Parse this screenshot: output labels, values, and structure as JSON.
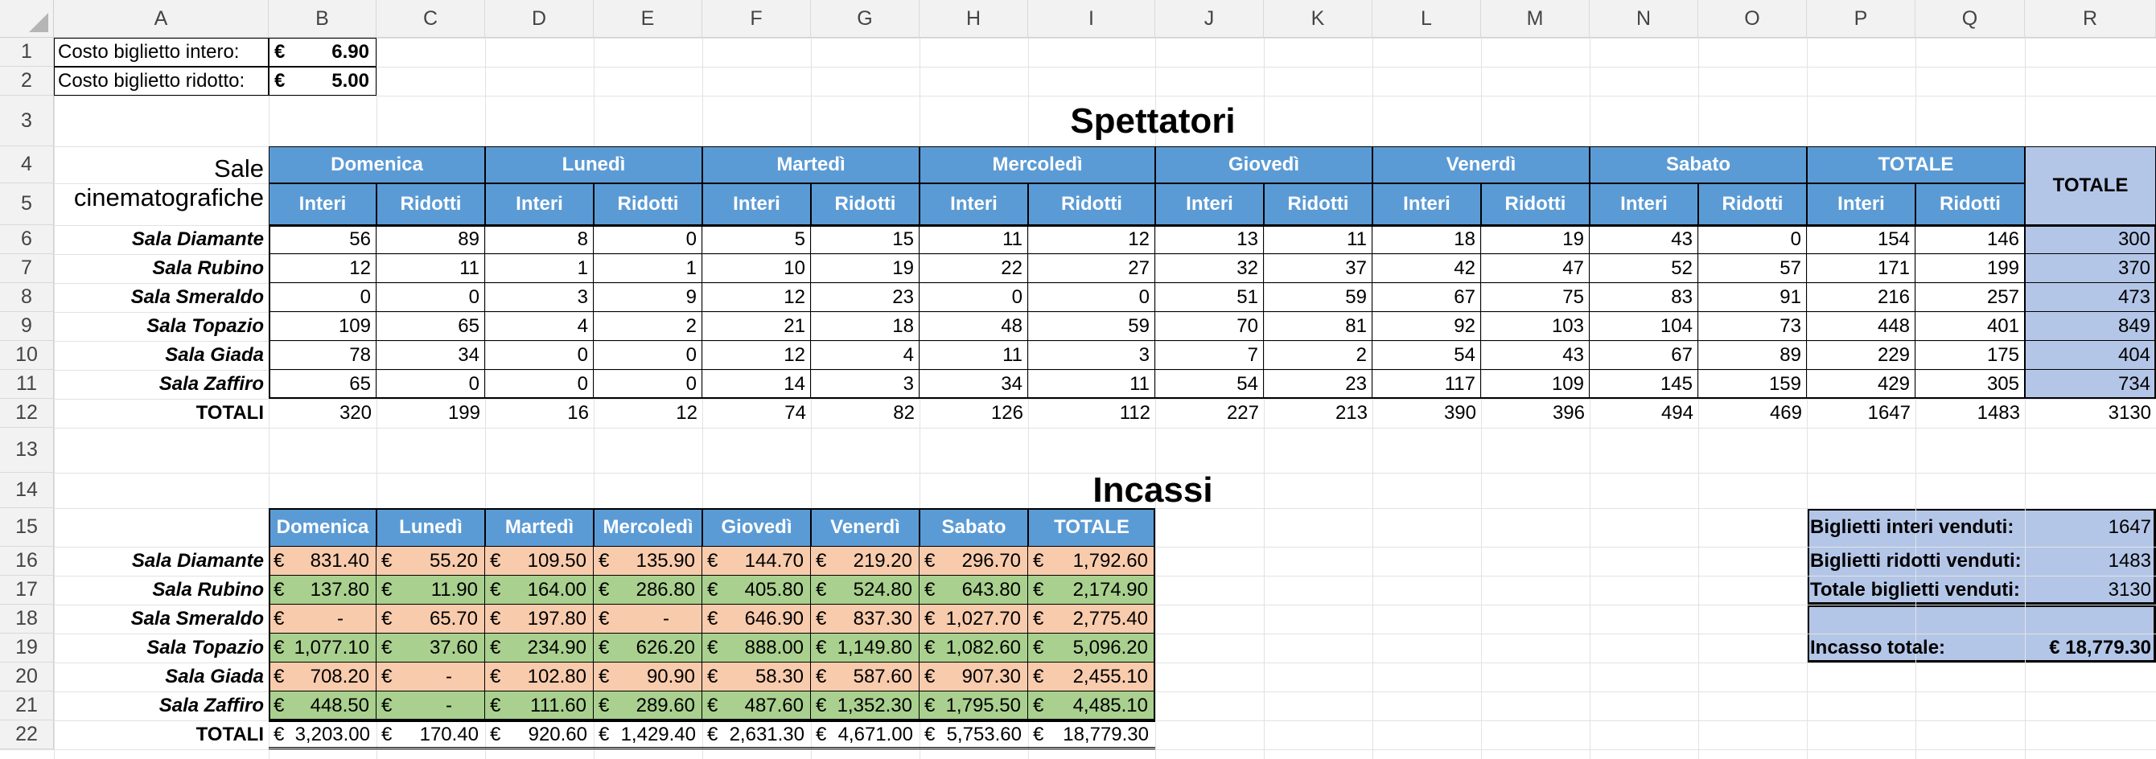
{
  "columns": [
    "A",
    "B",
    "C",
    "D",
    "E",
    "F",
    "G",
    "H",
    "I",
    "J",
    "K",
    "L",
    "M",
    "N",
    "O",
    "P",
    "Q",
    "R"
  ],
  "rows": [
    "1",
    "2",
    "3",
    "4",
    "5",
    "6",
    "7",
    "8",
    "9",
    "10",
    "11",
    "12",
    "13",
    "14",
    "15",
    "16",
    "17",
    "18",
    "19",
    "20",
    "21",
    "22"
  ],
  "prices": {
    "intero_label": "Costo biglietto intero:",
    "intero_cur": "€",
    "intero_val": "6.90",
    "ridotto_label": "Costo biglietto ridotto:",
    "ridotto_cur": "€",
    "ridotto_val": "5.00"
  },
  "spettatori": {
    "title": "Spettatori",
    "corner_label_1": "Sale",
    "corner_label_2": "cinematografiche",
    "days": [
      "Domenica",
      "Lunedì",
      "Martedì",
      "Mercoledì",
      "Giovedì",
      "Venerdì",
      "Sabato",
      "TOTALE"
    ],
    "sub": [
      "Interi",
      "Ridotti"
    ],
    "grand_header": "TOTALE",
    "rows": [
      {
        "name": "Sala Diamante",
        "vals": [
          "56",
          "89",
          "8",
          "0",
          "5",
          "15",
          "11",
          "12",
          "13",
          "11",
          "18",
          "19",
          "43",
          "0",
          "154",
          "146"
        ],
        "total": "300"
      },
      {
        "name": "Sala Rubino",
        "vals": [
          "12",
          "11",
          "1",
          "1",
          "10",
          "19",
          "22",
          "27",
          "32",
          "37",
          "42",
          "47",
          "52",
          "57",
          "171",
          "199"
        ],
        "total": "370"
      },
      {
        "name": "Sala Smeraldo",
        "vals": [
          "0",
          "0",
          "3",
          "9",
          "12",
          "23",
          "0",
          "0",
          "51",
          "59",
          "67",
          "75",
          "83",
          "91",
          "216",
          "257"
        ],
        "total": "473"
      },
      {
        "name": "Sala Topazio",
        "vals": [
          "109",
          "65",
          "4",
          "2",
          "21",
          "18",
          "48",
          "59",
          "70",
          "81",
          "92",
          "103",
          "104",
          "73",
          "448",
          "401"
        ],
        "total": "849"
      },
      {
        "name": "Sala Giada",
        "vals": [
          "78",
          "34",
          "0",
          "0",
          "12",
          "4",
          "11",
          "3",
          "7",
          "2",
          "54",
          "43",
          "67",
          "89",
          "229",
          "175"
        ],
        "total": "404"
      },
      {
        "name": "Sala Zaffiro",
        "vals": [
          "65",
          "0",
          "0",
          "0",
          "14",
          "3",
          "34",
          "11",
          "54",
          "23",
          "117",
          "109",
          "145",
          "159",
          "429",
          "305"
        ],
        "total": "734"
      }
    ],
    "totals_label": "TOTALI",
    "totals": [
      "320",
      "199",
      "16",
      "12",
      "74",
      "82",
      "126",
      "112",
      "227",
      "213",
      "390",
      "396",
      "494",
      "469",
      "1647",
      "1483"
    ],
    "grand_total": "3130"
  },
  "incassi": {
    "title": "Incassi",
    "headers": [
      "Domenica",
      "Lunedì",
      "Martedì",
      "Mercoledì",
      "Giovedì",
      "Venerdì",
      "Sabato",
      "TOTALE"
    ],
    "currency": "€",
    "rows": [
      {
        "name": "Sala Diamante",
        "vals": [
          "831.40",
          "55.20",
          "109.50",
          "135.90",
          "144.70",
          "219.20",
          "296.70",
          "1,792.60"
        ]
      },
      {
        "name": "Sala Rubino",
        "vals": [
          "137.80",
          "11.90",
          "164.00",
          "286.80",
          "405.80",
          "524.80",
          "643.80",
          "2,174.90"
        ]
      },
      {
        "name": "Sala Smeraldo",
        "vals": [
          "-",
          "65.70",
          "197.80",
          "-",
          "646.90",
          "837.30",
          "1,027.70",
          "2,775.40"
        ]
      },
      {
        "name": "Sala Topazio",
        "vals": [
          "1,077.10",
          "37.60",
          "234.90",
          "626.20",
          "888.00",
          "1,149.80",
          "1,082.60",
          "5,096.20"
        ]
      },
      {
        "name": "Sala Giada",
        "vals": [
          "708.20",
          "-",
          "102.80",
          "90.90",
          "58.30",
          "587.60",
          "907.30",
          "2,455.10"
        ]
      },
      {
        "name": "Sala Zaffiro",
        "vals": [
          "448.50",
          "-",
          "111.60",
          "289.60",
          "487.60",
          "1,352.30",
          "1,795.50",
          "4,485.10"
        ]
      }
    ],
    "totals_label": "TOTALI",
    "totals": [
      "3,203.00",
      "170.40",
      "920.60",
      "1,429.40",
      "2,631.30",
      "4,671.00",
      "5,753.60",
      "18,779.30"
    ]
  },
  "summary": {
    "interi_label": "Biglietti interi venduti:",
    "interi_val": "1647",
    "ridotti_label": "Biglietti ridotti venduti:",
    "ridotti_val": "1483",
    "totale_label": "Totale biglietti venduti:",
    "totale_val": "3130",
    "incasso_label": "Incasso totale:",
    "incasso_val": "€ 18,779.30"
  },
  "colors": {
    "header_blue": "#5b9bd5",
    "total_blue": "#b4c6e7",
    "peach": "#f8cbad",
    "green": "#a9d08e"
  }
}
